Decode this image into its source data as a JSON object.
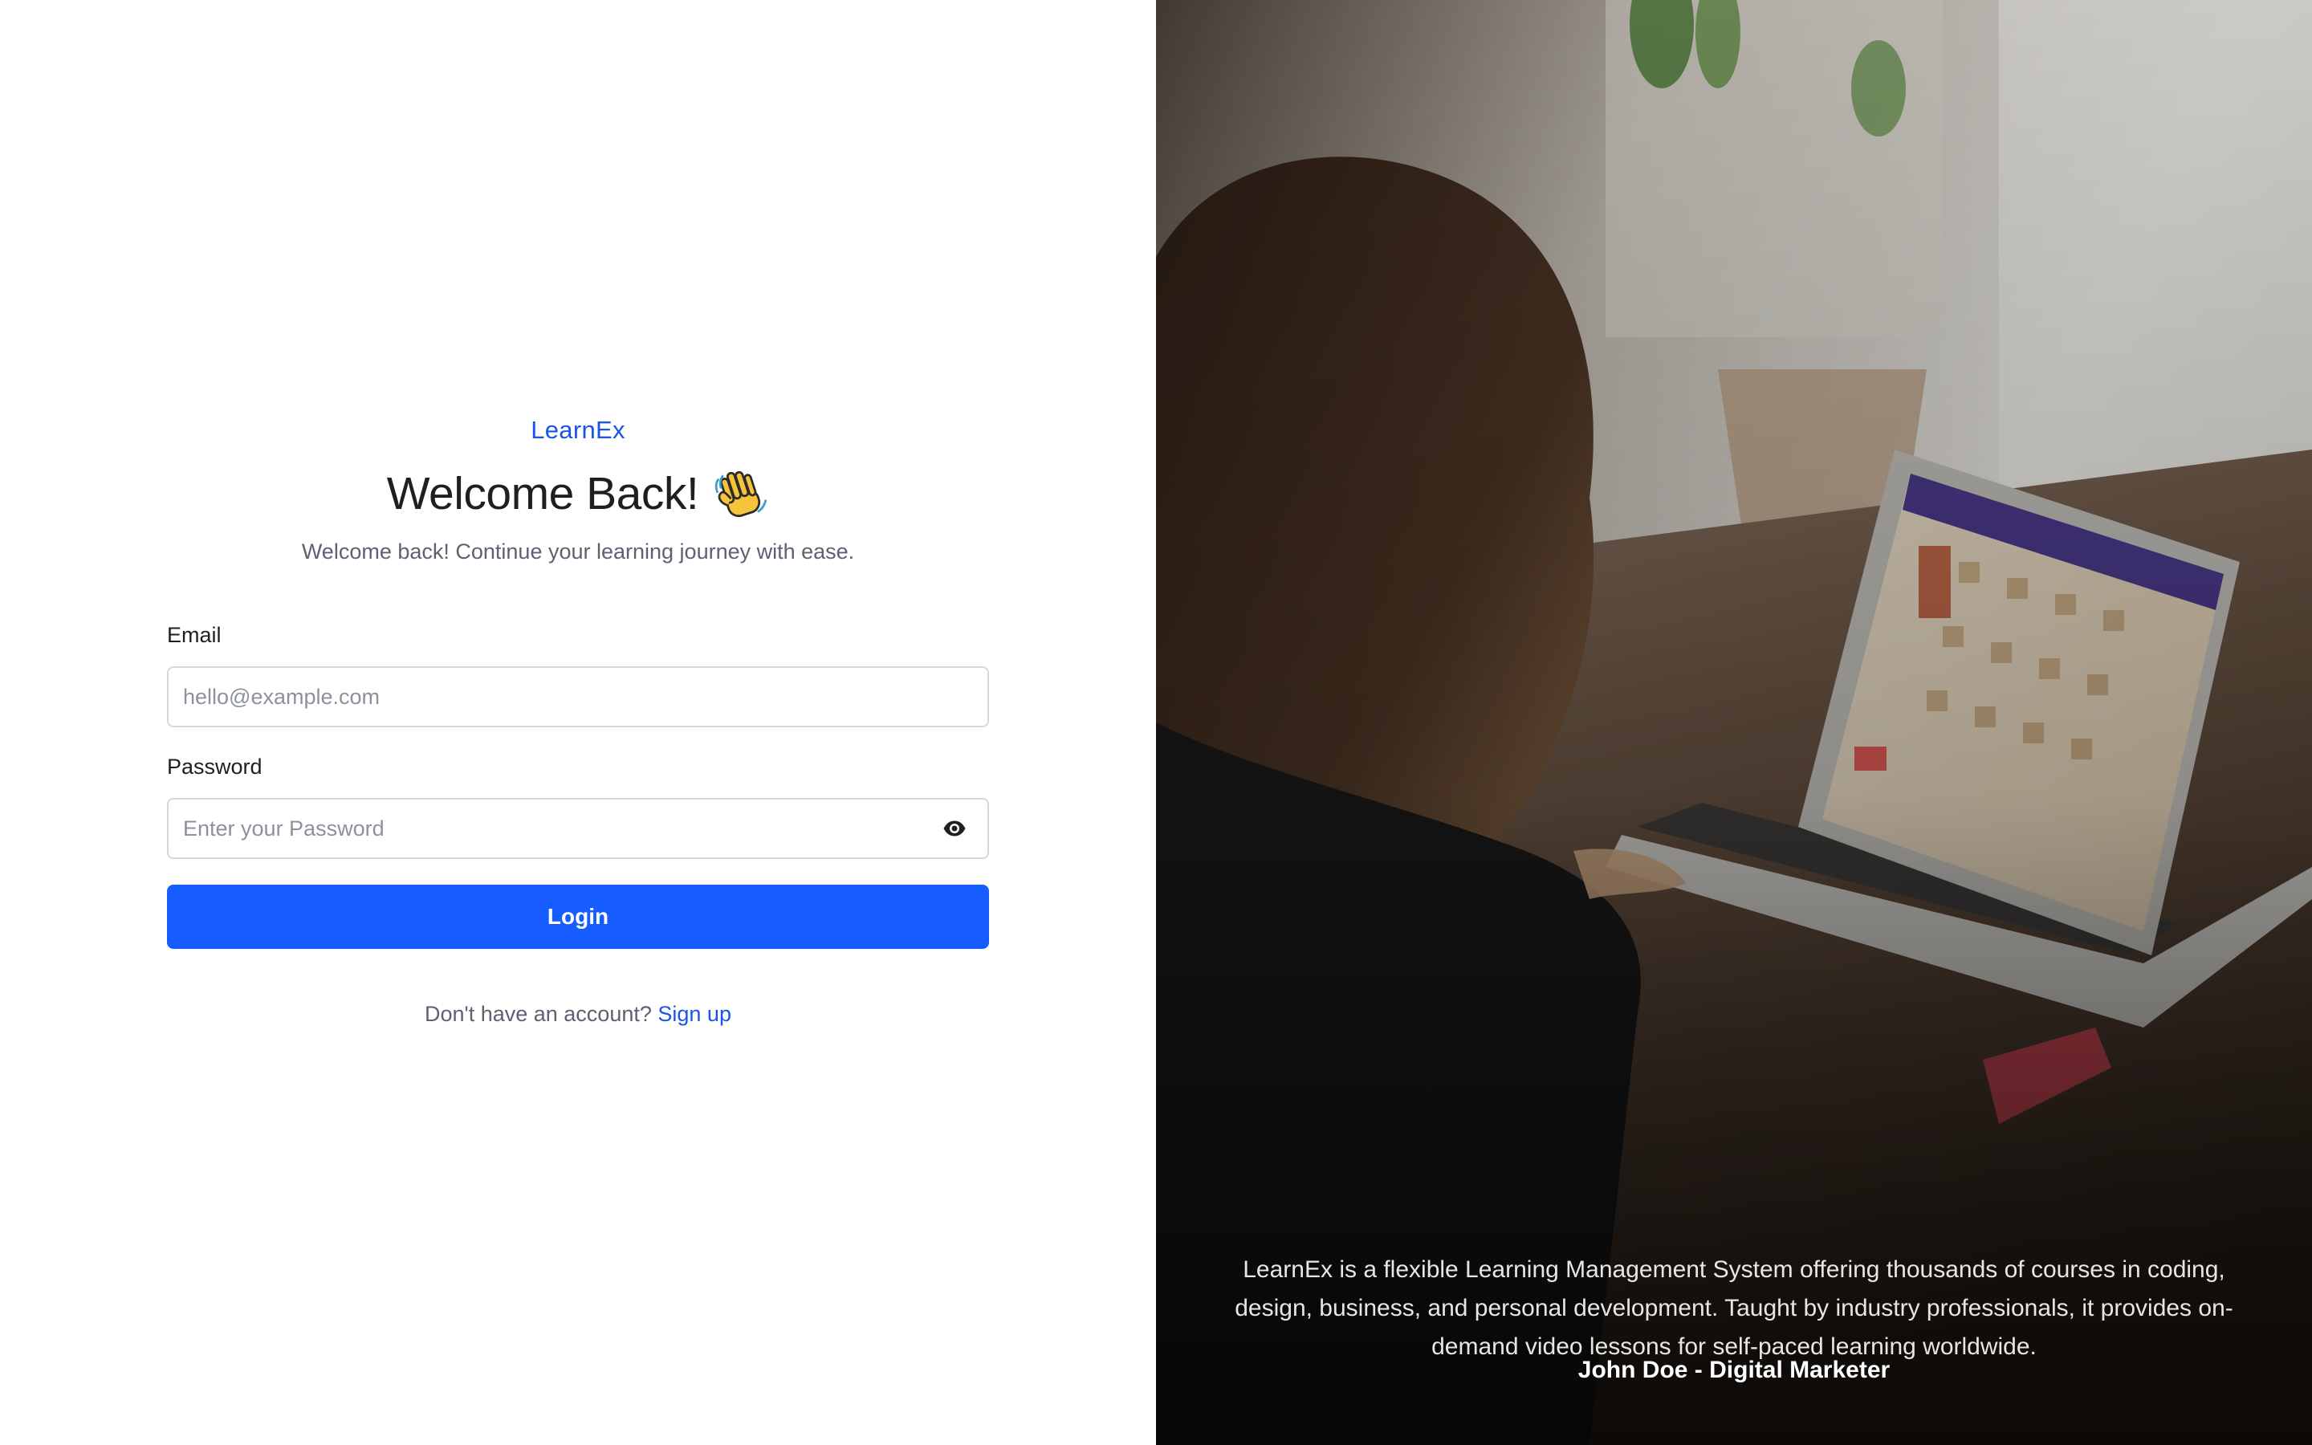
{
  "brand": {
    "name": "LearnEx"
  },
  "header": {
    "title": "Welcome Back!",
    "title_emoji": "waving-hand-icon",
    "subtitle": "Welcome back! Continue your learning journey with ease."
  },
  "form": {
    "email": {
      "label": "Email",
      "placeholder": "hello@example.com",
      "value": ""
    },
    "password": {
      "label": "Password",
      "placeholder": "Enter your Password",
      "value": "",
      "toggle_icon": "eye-icon"
    },
    "login_label": "Login",
    "signup_prompt": "Don't have an account?",
    "signup_link": "Sign up"
  },
  "testimonial": {
    "quote": "LearnEx is a flexible Learning Management System offering thousands of courses in coding, design, business, and personal development. Taught by industry professionals, it provides on-demand video lessons for self-paced learning worldwide.",
    "author": "John Doe - Digital Marketer"
  },
  "colors": {
    "accent": "#175cff",
    "brand_text": "#1a56e6",
    "heading": "#1f1f1f",
    "muted": "#5b6270",
    "input_border": "#d5d7dc"
  }
}
